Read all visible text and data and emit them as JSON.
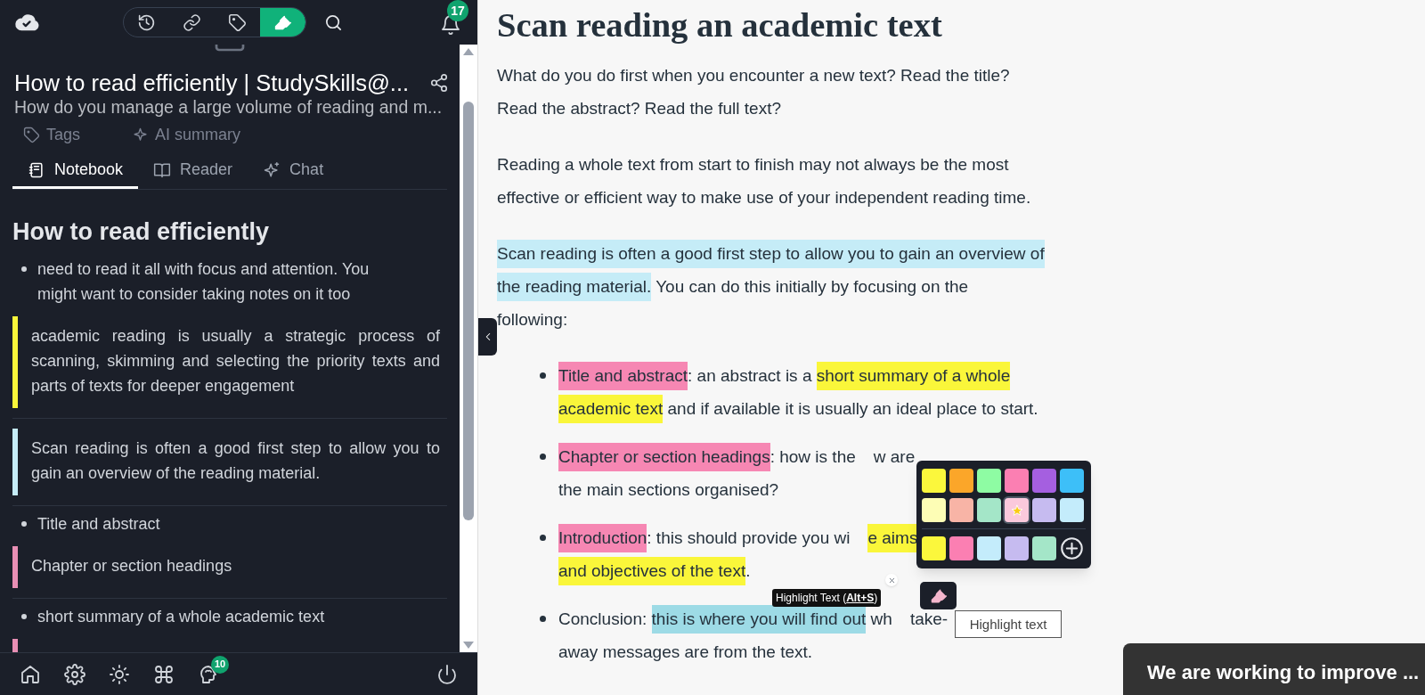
{
  "toolbar": {
    "items": [
      {
        "kind": "history",
        "selected": false
      },
      {
        "kind": "link",
        "selected": false
      },
      {
        "kind": "tag",
        "selected": false
      },
      {
        "kind": "highlighter",
        "selected": true
      }
    ],
    "notifications": "17"
  },
  "document": {
    "title": "How to read efficiently | StudySkills@...",
    "subtitle": "How do you manage a large volume of reading and m...",
    "actions": [
      "Tags",
      "AI summary"
    ]
  },
  "tabs": [
    {
      "label": "Notebook",
      "selected": true
    },
    {
      "label": "Reader",
      "selected": false
    },
    {
      "label": "Chat",
      "selected": false
    }
  ],
  "notebook": {
    "heading": "How to read efficiently",
    "notes": [
      {
        "kind": "bullet",
        "text": "need to read it all with focus and attention. You might want to consider taking notes on it too"
      },
      {
        "kind": "quote",
        "color": "#faf63a",
        "text": "academic reading is usually a strategic process of scanning, skimming and selecting the priority texts and parts of texts for deeper engagement"
      },
      {
        "kind": "quote",
        "color": "#c5ecf7",
        "text": "Scan reading is often a good first step to allow you to gain an overview of the reading material."
      },
      {
        "kind": "bullet",
        "text": "Title and abstract"
      },
      {
        "kind": "quote",
        "color": "#e88fb4",
        "text": "Chapter or section headings"
      },
      {
        "kind": "bullet",
        "text": "short summary of a whole academic text"
      },
      {
        "kind": "quote",
        "color": "#e88fb4"
      }
    ]
  },
  "bottom_bar": {
    "items": [
      {
        "kind": "home"
      },
      {
        "kind": "settings"
      },
      {
        "kind": "theme"
      },
      {
        "kind": "command"
      },
      {
        "kind": "brain",
        "badge": "10"
      },
      {
        "kind": "power"
      }
    ]
  },
  "article": {
    "heading": "Scan reading an academic text",
    "blocks": [
      {
        "kind": "paragraph",
        "lines": [
          [
            {
              "text": "What do you do first when you encounter a new text? Read the title?"
            }
          ],
          [
            {
              "text": "Read the abstract? Read the full text?"
            }
          ]
        ]
      },
      {
        "kind": "paragraph",
        "lines": [
          [
            {
              "text": "Reading a whole text from start to finish may not always be the most"
            }
          ],
          [
            {
              "text": "effective or efficient way to make use of your independent reading time."
            }
          ]
        ]
      },
      {
        "kind": "paragraph",
        "lines": [
          [
            {
              "text": "Scan reading is often a good first step to allow you to gain an overview of",
              "color": "#c5ecf7"
            }
          ],
          [
            {
              "text": "the reading material.",
              "color": "#c5ecf7"
            },
            {
              "text": " You can do this initially by focusing on the"
            }
          ],
          [
            {
              "text": "following:"
            }
          ]
        ]
      },
      {
        "kind": "bullet",
        "lines": [
          [
            {
              "text": "Title and abstract",
              "color": "#f687b3"
            },
            {
              "text": ": an abstract is a "
            },
            {
              "text": "short summary of a whole",
              "color": "#faf63a"
            }
          ],
          [
            {
              "text": "academic text",
              "color": "#faf63a"
            },
            {
              "text": " and if available it is usually an ideal place to start."
            }
          ]
        ]
      },
      {
        "kind": "bullet",
        "lines": [
          [
            {
              "text": "Chapter or section headings",
              "color": "#f687b3"
            },
            {
              "text": ": how is the"
            },
            {
              "gap": true
            },
            {
              "text": "w are"
            }
          ],
          [
            {
              "text": "the main sections organised?"
            }
          ]
        ]
      },
      {
        "kind": "bullet",
        "lines": [
          [
            {
              "text": "Introduction",
              "color": "#f687b3"
            },
            {
              "text": ": this should provide you wi"
            },
            {
              "gap": true
            },
            {
              "text": "e aims",
              "color": "#faf63a"
            }
          ],
          [
            {
              "text": "and objectives of the text",
              "color": "#faf63a"
            },
            {
              "text": "."
            }
          ]
        ]
      },
      {
        "kind": "bullet",
        "lines": [
          [
            {
              "text": "Conclusion: "
            },
            {
              "text": "this is where you will find out",
              "color": "#9ddbe6"
            },
            {
              "text": " wh"
            },
            {
              "gap": true
            },
            {
              "text": "take-"
            }
          ],
          [
            {
              "text": "away messages are from the text."
            }
          ]
        ]
      }
    ]
  },
  "palette": {
    "rows": [
      [
        {
          "color": "#fbf73c",
          "selected": false
        },
        {
          "color": "#fba629",
          "selected": false
        },
        {
          "color": "#8efca3",
          "selected": false
        },
        {
          "color": "#fb7fb2",
          "selected": false
        },
        {
          "color": "#a55fe0",
          "selected": false
        },
        {
          "color": "#3dbff8",
          "selected": false
        }
      ],
      [
        {
          "color": "#fdfdb5",
          "selected": false
        },
        {
          "color": "#f8b4a6",
          "selected": false
        },
        {
          "color": "#a4e6c8",
          "selected": false
        },
        {
          "color": "#fbc9dc",
          "selected": true
        },
        {
          "color": "#c6bbf0",
          "selected": false
        },
        {
          "color": "#c4ecfb",
          "selected": false
        }
      ],
      [
        {
          "color": "#fbf73c",
          "selected": false
        },
        {
          "color": "#fb7fb2",
          "selected": false
        },
        {
          "color": "#c4ecfb",
          "selected": false
        },
        {
          "color": "#c6bbf0",
          "selected": false
        },
        {
          "color": "#a4e6c8",
          "selected": false
        }
      ]
    ]
  },
  "shortcut_tooltip": "Highlight Text (**Alt+S**)",
  "highlight_tooltip": "Highlight text",
  "toast": "We are working to improve ..."
}
